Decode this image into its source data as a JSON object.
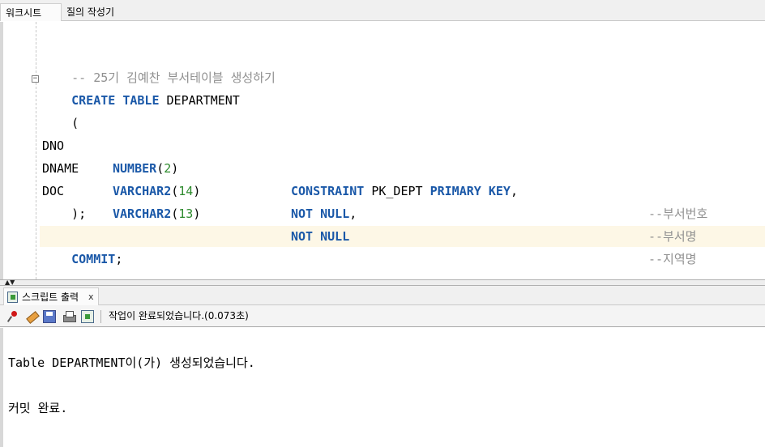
{
  "tabs": {
    "worksheet": "워크시트",
    "query_builder": "질의 작성기"
  },
  "editor": {
    "comment_line": "-- 25기 김예찬 부서테이블 생성하기",
    "create_kw": "CREATE",
    "table_kw": "TABLE",
    "table_name": "DEPARTMENT",
    "open_paren": "(",
    "rows": [
      {
        "col": "DNO",
        "type": "NUMBER",
        "lparen": "(",
        "size": "2",
        "rparen": ")",
        "c1": "CONSTRAINT",
        "cname": "PK_DEPT",
        "c2": "PRIMARY KEY",
        "trail": ",",
        "comment": "--부서번호"
      },
      {
        "col": "DNAME",
        "type": "VARCHAR2",
        "lparen": "(",
        "size": "14",
        "rparen": ")",
        "c1": "NOT NULL",
        "trail": ",",
        "comment": "--부서명"
      },
      {
        "col": "DOC",
        "type": "VARCHAR2",
        "lparen": "(",
        "size": "13",
        "rparen": ")",
        "c1": "NOT NULL",
        "comment": "--지역명"
      }
    ],
    "close_paren": ");",
    "commit_kw": "COMMIT",
    "commit_semicolon": ";"
  },
  "output_panel": {
    "tab_label": "스크립트 출력",
    "tab_close": "x",
    "status": "작업이 완료되었습니다.(0.073초)",
    "lines": [
      "Table DEPARTMENT이(가) 생성되었습니다.",
      "커밋 완료."
    ]
  },
  "colors": {
    "keyword": "#1a58a8",
    "number": "#2d8a2d",
    "comment": "#909090",
    "current_line": "#fdf7e6"
  },
  "icons": [
    "pin-icon",
    "eraser-icon",
    "save-icon",
    "print-icon",
    "script-output-icon"
  ]
}
